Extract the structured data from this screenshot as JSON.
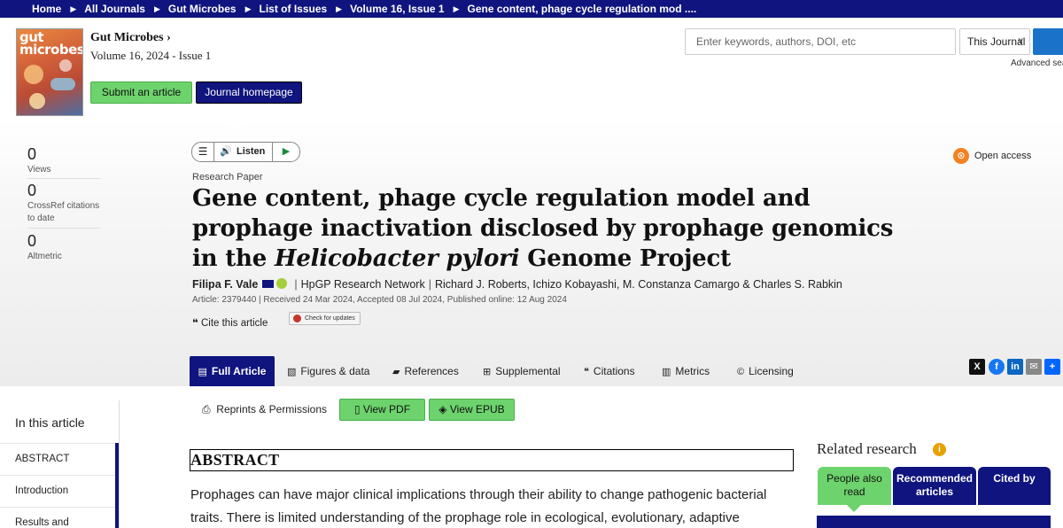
{
  "breadcrumb": {
    "items": [
      "Home",
      "All Journals",
      "Gut Microbes",
      "List of Issues",
      "Volume 16, Issue 1",
      "Gene content, phage cycle regulation mod ...."
    ]
  },
  "header": {
    "cover_text": "gut microbes",
    "journal_title": "Gut Microbes",
    "volume": "Volume 16, 2024 - Issue 1",
    "submit_label": "Submit an article",
    "homepage_label": "Journal homepage",
    "search_placeholder": "Enter keywords, authors, DOI, etc",
    "scope_value": "This Journal",
    "advanced_label": "Advanced sea"
  },
  "metrics": [
    {
      "value": "0",
      "label": "Views"
    },
    {
      "value": "0",
      "label": "CrossRef citations to date"
    },
    {
      "value": "0",
      "label": "Altmetric"
    }
  ],
  "listen": {
    "label": "Listen"
  },
  "open_access": "Open access",
  "article": {
    "kind": "Research Paper",
    "title_part1": "Gene content, phage cycle regulation model and prophage inactivation disclosed by prophage genomics in the ",
    "title_italic": "Helicobacter pylori",
    "title_part2": " Genome Project",
    "author_first": "Filipa F. Vale",
    "author_group": "HpGP Research Network",
    "author_rest": "Richard J. Roberts, Ichizo Kobayashi, M. Constanza Camargo & Charles S. Rabkin",
    "dates": "Article: 2379440 | Received 24 Mar 2024, Accepted 08 Jul 2024, Published online: 12 Aug 2024",
    "cite_label": "Cite this article",
    "update_label": "Check for updates"
  },
  "tabs": [
    {
      "label": "Full Article",
      "icon": "document-icon"
    },
    {
      "label": "Figures & data",
      "icon": "image-icon"
    },
    {
      "label": "References",
      "icon": "book-icon"
    },
    {
      "label": "Supplemental",
      "icon": "plus-icon"
    },
    {
      "label": "Citations",
      "icon": "quote-icon"
    },
    {
      "label": "Metrics",
      "icon": "bar-chart-icon"
    },
    {
      "label": "Licensing",
      "icon": "copyright-icon"
    }
  ],
  "actions": {
    "reprints": "Reprints & Permissions",
    "view_pdf": "View PDF",
    "view_epub": "View EPUB"
  },
  "toc": {
    "heading": "In this article",
    "items": [
      "ABSTRACT",
      "Introduction",
      "Results and"
    ]
  },
  "abstract": {
    "heading": "ABSTRACT",
    "text": "Prophages can have major clinical implications through their ability to change pathogenic bacterial traits. There is limited understanding of the prophage role in ecological, evolutionary, adaptive"
  },
  "related": {
    "heading": "Related research",
    "tabs": [
      "People also read",
      "Recommended articles",
      "Cited by"
    ]
  },
  "colors": {
    "brand_navy": "#10147e",
    "green_button": "#6dd36d",
    "open_access_orange": "#f48120"
  }
}
